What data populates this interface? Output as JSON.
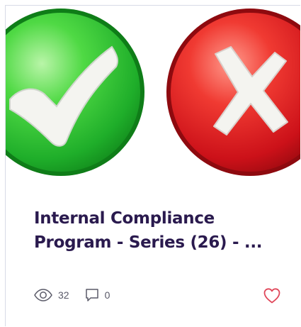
{
  "post": {
    "title": "Internal Compliance Program - Series (26) - ...",
    "views": "32",
    "comments": "0",
    "liked": false
  },
  "icons": {
    "views": "eye-icon",
    "comments": "comment-bubble-icon",
    "like": "heart-icon",
    "thumbnail_left": "green-check-icon",
    "thumbnail_right": "red-x-icon"
  },
  "colors": {
    "title": "#2a1a4e",
    "heart": "#e0475a",
    "check_green": "#2fc234",
    "x_red": "#d4171f",
    "border": "#d7dbe6"
  }
}
